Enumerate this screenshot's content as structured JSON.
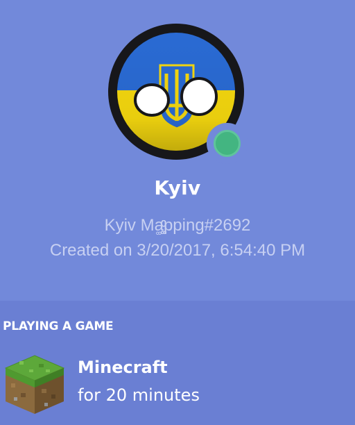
{
  "profile": {
    "username": "Kyiv",
    "tag": "Kyiv Ma͚͚͚͚͚͚͚͚͚͚͚͚͚͚͚ͨͨͨͨͨͨͨͨͨͨͨͨͨͨͨͨpping#2692",
    "created": "Created on 3/20/2017, 6:54:40 PM",
    "status": "online",
    "avatar_icon": "countryball-ukraine-avatar",
    "colors": {
      "background": "#7289da",
      "status_online": "#43b581",
      "flag_blue": "#2a6bd4",
      "flag_yellow": "#f5d80f"
    }
  },
  "activity": {
    "header": "PLAYING A GAME",
    "game_icon": "minecraft-grass-block-icon",
    "game_name": "Minecraft",
    "duration": "for 20 minutes"
  }
}
